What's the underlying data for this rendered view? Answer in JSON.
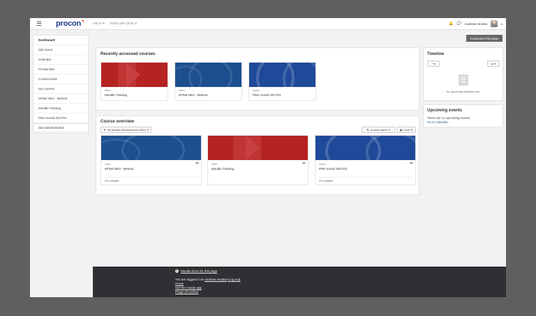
{
  "navbar": {
    "logo": "procon",
    "help": "HELP",
    "language": "ENGLISH (EN)",
    "user_name": "Andreas Hruska",
    "icons": [
      "menu-icon",
      "bell-icon",
      "chat-icon",
      "chevron-down-icon"
    ]
  },
  "drawer": {
    "items": [
      {
        "label": "Dashboard",
        "active": true
      },
      {
        "label": "Site home"
      },
      {
        "label": "Calendar"
      },
      {
        "label": "Private files"
      },
      {
        "label": "Content bank"
      },
      {
        "label": "My courses"
      },
      {
        "label": "ePSM NEU - Betreut"
      },
      {
        "label": "Moodle Training"
      },
      {
        "label": "PMA mondi 2017/01"
      }
    ],
    "admin": "Site administration"
  },
  "customise": "Customise this page",
  "recent": {
    "title": "Recently accessed courses",
    "courses": [
      {
        "category": "intern",
        "name": "Moodle Training",
        "color": "#b52323"
      },
      {
        "category": "intern",
        "name": "ePSM NEU - Betreut",
        "color": "#1d4f8f"
      },
      {
        "category": "mondi",
        "name": "PMA mondi 2017/01",
        "color": "#1f4a99"
      }
    ]
  },
  "overview": {
    "title": "Course overview",
    "filter": "All (except removed from view)",
    "sort": "Course name",
    "view": "Card",
    "courses": [
      {
        "category": "intern",
        "name": "ePSM NEU - Betreut",
        "progress": "0% complete",
        "color": "#1d4f8f"
      },
      {
        "category": "intern",
        "name": "Moodle Training",
        "progress": "",
        "color": "#b52323"
      },
      {
        "category": "mondi",
        "name": "PMA mondi 2017/01",
        "progress": "0% complete",
        "color": "#1f4a99"
      }
    ]
  },
  "timeline": {
    "title": "Timeline",
    "empty": "No upcoming activities due"
  },
  "upcoming": {
    "title": "Upcoming events",
    "text": "There are no upcoming events",
    "link": "Go to calendar..."
  },
  "footer": {
    "docs": "Moodle Docs for this page",
    "logged_prefix": "You are logged in as",
    "logged_user": "Andreas Hruska",
    "logout": "(Log out)",
    "home": "Home",
    "mobile": "Get the mobile app",
    "purge": "Purge all caches"
  }
}
